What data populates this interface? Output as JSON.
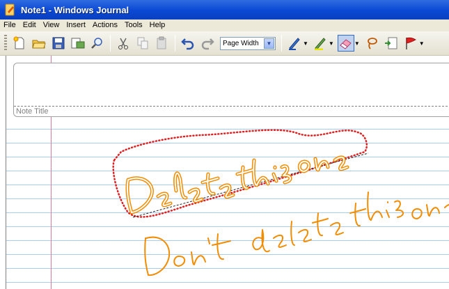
{
  "window": {
    "title": "Note1 - Windows Journal"
  },
  "menu": [
    "File",
    "Edit",
    "View",
    "Insert",
    "Actions",
    "Tools",
    "Help"
  ],
  "toolbar": {
    "zoom_value": "Page Width"
  },
  "note": {
    "title_placeholder": "Note Title",
    "selected_ink": "Delete this one",
    "unselected_ink": "Don't delete this one"
  },
  "colors": {
    "ink": "#f28c00",
    "selection": "#e02020",
    "rule": "#a8ccec",
    "margin": "#d97a9a"
  }
}
